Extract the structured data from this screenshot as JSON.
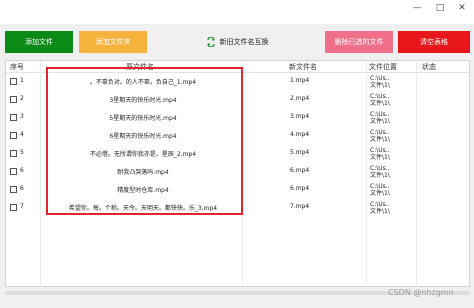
{
  "window": {
    "controls": {
      "minimize": "—",
      "maximize": "□",
      "close": "✕"
    }
  },
  "toolbar": {
    "add_file": "添加文件",
    "add_folder": "添加文件夹",
    "swap_names": "新旧文件名互换",
    "delete_selected": "删除已选的文件",
    "clear_table": "清空表格"
  },
  "table": {
    "headers": [
      "序号",
      "原文件名",
      "新文件名",
      "文件位置",
      "状态"
    ],
    "rows": [
      {
        "seq": "1",
        "original": "。不辜负对。的人不辜。负自己_1.mp4",
        "new": "1.mp4",
        "location": [
          "C:\\Us..",
          "文件\\1\\"
        ]
      },
      {
        "seq": "2",
        "original": "3星期天的快乐时光.mp4",
        "new": "2.mp4",
        "location": [
          "C:\\Us..",
          "文件\\1\\"
        ]
      },
      {
        "seq": "3",
        "original": "5星期天的快乐时光.mp4",
        "new": "3.mp4",
        "location": [
          "C:\\Us..",
          "文件\\1\\"
        ]
      },
      {
        "seq": "4",
        "original": "6星期天的快乐时光.mp4",
        "new": "4.mp4",
        "location": [
          "C:\\Us..",
          "文件\\1\\"
        ]
      },
      {
        "seq": "5",
        "original": "不必借。无所谓你我亦是。星辰_2.mp4",
        "new": "5.mp4",
        "location": [
          "C:\\Us..",
          "文件\\1\\"
        ]
      },
      {
        "seq": "6",
        "original": "耐我凸哭落吗.mp4",
        "new": "6.mp4",
        "location": [
          "C:\\Us..",
          "文件\\1\\"
        ]
      },
      {
        "seq": "6",
        "original": "精度型时仓库.mp4",
        "new": "6.mp4",
        "location": [
          "C:\\Us..",
          "文件\\1\\"
        ]
      },
      {
        "seq": "7",
        "original": "希望你。每。个称。天今。天明天。都快快。乐_3.mp4",
        "new": "7.mp4",
        "location": [
          "C:\\Us..",
          "文件\\1\\"
        ]
      }
    ]
  },
  "watermark": "CSDN @nhzgmn",
  "colors": {
    "add_file": "#0c8a18",
    "add_folder": "#f5b23d",
    "delete_selected": "#f06f89",
    "clear_table": "#e8161a",
    "highlight_box": "#e0262b"
  },
  "icons": {
    "swap": "swap-arrows-icon"
  }
}
